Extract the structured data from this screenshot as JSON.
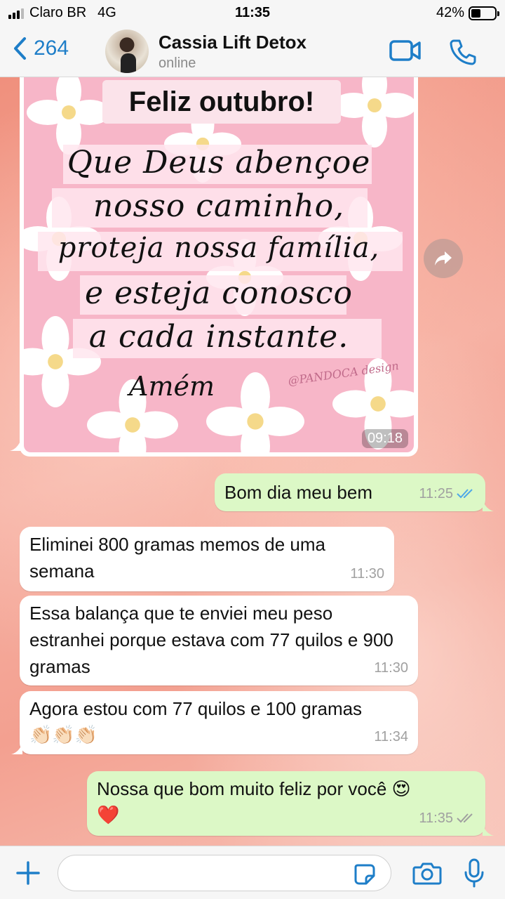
{
  "status_bar": {
    "carrier": "Claro BR",
    "network": "4G",
    "time": "11:35",
    "battery": "42%",
    "battery_level": 0.42
  },
  "header": {
    "back_count": "264",
    "contact_name": "Cassia Lift Detox",
    "contact_status": "online",
    "accent_color": "#1e7ec8"
  },
  "image_message": {
    "card_title": "Feliz outubro!",
    "lines": [
      "Que Deus abençoe",
      "nosso caminho,",
      "proteja nossa família,",
      "e esteja conosco",
      "a cada instante."
    ],
    "closing": "Amém",
    "credit": "@PANDOCA design",
    "time": "09:18"
  },
  "messages": [
    {
      "id": "m1",
      "direction": "out",
      "text": "Bom dia meu bem",
      "time": "11:25",
      "status": "read"
    },
    {
      "id": "m2",
      "direction": "in",
      "text": "Eliminei 800 gramas memos de uma semana",
      "time": "11:30"
    },
    {
      "id": "m3",
      "direction": "in",
      "text": "Essa balança que te enviei meu peso estranhei porque estava com 77 quilos e 900 gramas",
      "time": "11:30"
    },
    {
      "id": "m4",
      "direction": "in",
      "text": "Agora estou com 77 quilos e 100 gramas",
      "emoji": "👏🏻👏🏻👏🏻",
      "time": "11:34"
    },
    {
      "id": "m5",
      "direction": "out",
      "text": "Nossa que bom muito feliz por você",
      "emoji_inline": "😍",
      "emoji": "❤️",
      "time": "11:35",
      "status": "delivered"
    }
  ],
  "input": {
    "placeholder": ""
  },
  "colors": {
    "incoming_bubble": "#ffffff",
    "outgoing_bubble": "#dcf8c6",
    "read_ticks": "#4fa8e8",
    "delivered_ticks": "#a0a0a0"
  }
}
